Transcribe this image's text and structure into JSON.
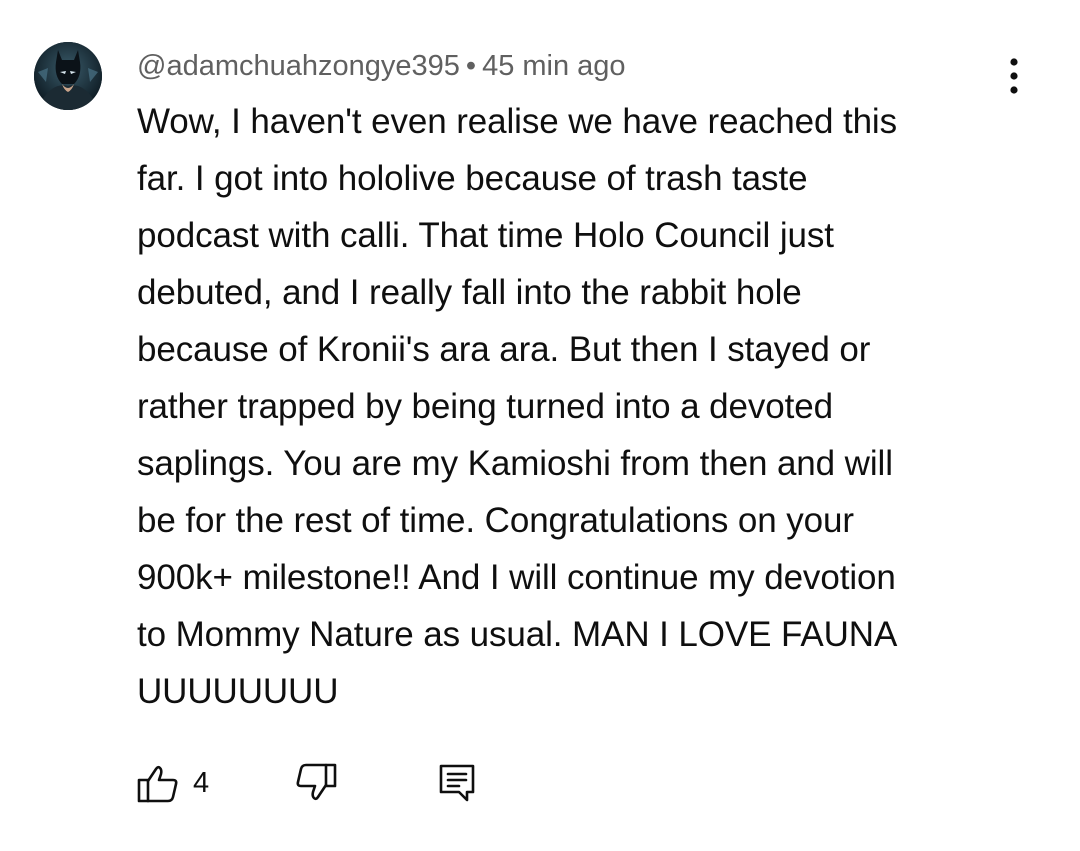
{
  "comment": {
    "author": "@adamchuahzongye395",
    "separator": "•",
    "timestamp": "45 min ago",
    "text_lines": [
      "Wow, I haven't even realise we have reached this",
      "far. I got into hololive because of trash taste",
      "podcast with calli. That time Holo Council just",
      "debuted, and I really fall into the rabbit hole",
      "because of Kronii's ara ara. But then I stayed or",
      "rather trapped by being turned into a devoted",
      "saplings. You are my Kamioshi from then and will",
      "be for the rest of time. Congratulations on your",
      "900k+ milestone!! And I will continue my devotion",
      "to Mommy Nature as usual. MAN I LOVE FAUNA",
      "UUUUUUUU"
    ],
    "like_count": "4"
  },
  "icons": {
    "avatar": "avatar-image",
    "menu": "more-vert-icon",
    "like": "thumb-up-icon",
    "dislike": "thumb-down-icon",
    "reply": "reply-comment-icon"
  },
  "colors": {
    "text": "#0f0f0f",
    "meta": "#606060",
    "icon": "#0f0f0f",
    "background": "#ffffff"
  }
}
